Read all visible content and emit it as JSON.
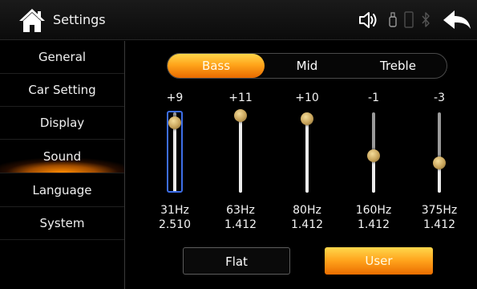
{
  "header": {
    "title": "Settings",
    "icons": [
      "home-icon",
      "speaker-icon",
      "usb-icon",
      "phone-icon",
      "bluetooth-icon",
      "back-arrow-icon"
    ]
  },
  "sidebar": {
    "items": [
      {
        "label": "General"
      },
      {
        "label": "Car Setting"
      },
      {
        "label": "Display"
      },
      {
        "label": "Sound",
        "active": true
      },
      {
        "label": "Language"
      },
      {
        "label": "System"
      }
    ]
  },
  "band_tabs": {
    "items": [
      {
        "label": "Bass",
        "active": true
      },
      {
        "label": "Mid"
      },
      {
        "label": "Treble"
      }
    ]
  },
  "equalizer": {
    "gain_range": [
      -12,
      12
    ],
    "selected_band": 0,
    "bands": [
      {
        "gain": "+9",
        "gain_value": 9,
        "freq": "31Hz",
        "q": "2.510"
      },
      {
        "gain": "+11",
        "gain_value": 11,
        "freq": "63Hz",
        "q": "1.412"
      },
      {
        "gain": "+10",
        "gain_value": 10,
        "freq": "80Hz",
        "q": "1.412"
      },
      {
        "gain": "-1",
        "gain_value": -1,
        "freq": "160Hz",
        "q": "1.412"
      },
      {
        "gain": "-3",
        "gain_value": -3,
        "freq": "375Hz",
        "q": "1.412"
      }
    ]
  },
  "presets": {
    "flat_label": "Flat",
    "user_label": "User",
    "selected": "User"
  },
  "colors": {
    "accent_orange": "#ffa21b",
    "selected_band_outline": "#3d6ee8",
    "knob_gold": "#c7a35a",
    "background": "#000000"
  }
}
